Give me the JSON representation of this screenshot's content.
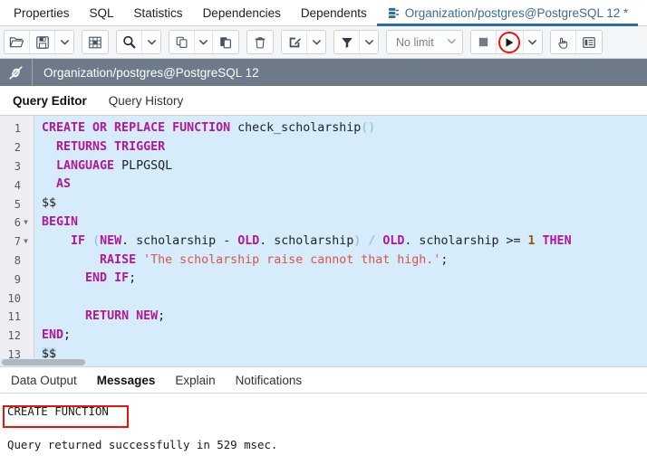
{
  "object_tabs": [
    {
      "label": "Properties",
      "active": false,
      "icon": null
    },
    {
      "label": "SQL",
      "active": false,
      "icon": null
    },
    {
      "label": "Statistics",
      "active": false,
      "icon": null
    },
    {
      "label": "Dependencies",
      "active": false,
      "icon": null
    },
    {
      "label": "Dependents",
      "active": false,
      "icon": null
    },
    {
      "label": "Organization/postgres@PostgreSQL 12 *",
      "active": true,
      "icon": "database-icon"
    }
  ],
  "toolbar": {
    "groups": [
      {
        "buttons": [
          {
            "name": "open-file-button",
            "icon": "open-folder-icon",
            "title": "Open File"
          },
          {
            "name": "save-file-button",
            "icon": "save-disk-icon",
            "title": "Save File"
          },
          {
            "name": "save-dropdown-button",
            "icon": "chevron-down-icon",
            "title": "Save options"
          }
        ]
      },
      {
        "buttons": [
          {
            "name": "edit-grid-button",
            "icon": "grid-icon",
            "title": "Edit grid"
          }
        ]
      },
      {
        "buttons": [
          {
            "name": "find-button",
            "icon": "search-icon",
            "title": "Find"
          },
          {
            "name": "find-dropdown-button",
            "icon": "chevron-down-icon",
            "title": "Find options"
          }
        ]
      },
      {
        "buttons": [
          {
            "name": "copy-button",
            "icon": "copy-icon",
            "title": "Copy"
          },
          {
            "name": "copy-dropdown-button",
            "icon": "chevron-down-icon",
            "title": "Copy options"
          },
          {
            "name": "paste-button",
            "icon": "paste-icon",
            "title": "Paste"
          }
        ]
      },
      {
        "buttons": [
          {
            "name": "delete-button",
            "icon": "trash-icon",
            "title": "Delete"
          }
        ]
      },
      {
        "buttons": [
          {
            "name": "edit-button",
            "icon": "pencil-square-icon",
            "title": "Edit"
          },
          {
            "name": "edit-dropdown-button",
            "icon": "chevron-down-icon",
            "title": "Edit options"
          }
        ]
      },
      {
        "buttons": [
          {
            "name": "filter-button",
            "icon": "funnel-icon",
            "title": "Filter"
          },
          {
            "name": "filter-dropdown-button",
            "icon": "chevron-down-icon",
            "title": "Filter options"
          }
        ]
      }
    ],
    "limit_label": "No limit",
    "limit_caret_icon": "chevron-down-icon",
    "stop_button": {
      "name": "stop-query-button",
      "icon": "stop-square-icon"
    },
    "play_button": {
      "name": "execute-query-button",
      "icon": "play-triangle-icon",
      "highlighted": true
    },
    "play_dropdown": {
      "name": "execute-dropdown-button",
      "icon": "chevron-down-icon"
    },
    "hand_button": {
      "name": "macro-hand-button",
      "icon": "hand-pointer-icon"
    },
    "panel_button": {
      "name": "panel-toggle-button",
      "icon": "list-panel-icon"
    }
  },
  "connection_bar": {
    "icon": "disconnect-plug-icon",
    "title": "Organization/postgres@PostgreSQL 12"
  },
  "editor_tabs": [
    {
      "label": "Query Editor",
      "active": true
    },
    {
      "label": "Query History",
      "active": false
    }
  ],
  "code": {
    "lines": [
      {
        "n": 1,
        "fold": false,
        "tokens": [
          {
            "t": "CREATE OR REPLACE FUNCTION",
            "c": "kw"
          },
          {
            "t": " check_scholarship",
            "c": "plain"
          },
          {
            "t": "()",
            "c": "paren"
          }
        ]
      },
      {
        "n": 2,
        "fold": false,
        "tokens": [
          {
            "t": "  ",
            "c": "plain"
          },
          {
            "t": "RETURNS TRIGGER",
            "c": "kw"
          }
        ]
      },
      {
        "n": 3,
        "fold": false,
        "tokens": [
          {
            "t": "  ",
            "c": "plain"
          },
          {
            "t": "LANGUAGE",
            "c": "kw"
          },
          {
            "t": " PLPGSQL",
            "c": "plain"
          }
        ]
      },
      {
        "n": 4,
        "fold": false,
        "tokens": [
          {
            "t": "  ",
            "c": "plain"
          },
          {
            "t": "AS",
            "c": "kw"
          }
        ]
      },
      {
        "n": 5,
        "fold": false,
        "tokens": [
          {
            "t": "$$",
            "c": "plain"
          }
        ]
      },
      {
        "n": 6,
        "fold": true,
        "tokens": [
          {
            "t": "BEGIN",
            "c": "kw"
          }
        ]
      },
      {
        "n": 7,
        "fold": true,
        "tokens": [
          {
            "t": "    ",
            "c": "plain"
          },
          {
            "t": "IF",
            "c": "kw"
          },
          {
            "t": " ",
            "c": "plain"
          },
          {
            "t": "(",
            "c": "paren"
          },
          {
            "t": "NEW",
            "c": "kw"
          },
          {
            "t": ". scholarship ",
            "c": "plain"
          },
          {
            "t": "-",
            "c": "plain"
          },
          {
            "t": " ",
            "c": "plain"
          },
          {
            "t": "OLD",
            "c": "kw"
          },
          {
            "t": ". scholarship",
            "c": "plain"
          },
          {
            "t": ")",
            "c": "paren"
          },
          {
            "t": " ",
            "c": "plain"
          },
          {
            "t": "/",
            "c": "paren"
          },
          {
            "t": " ",
            "c": "plain"
          },
          {
            "t": "OLD",
            "c": "kw"
          },
          {
            "t": ". scholarship >= ",
            "c": "plain"
          },
          {
            "t": "1",
            "c": "num-lit"
          },
          {
            "t": " ",
            "c": "plain"
          },
          {
            "t": "THEN",
            "c": "kw"
          }
        ]
      },
      {
        "n": 8,
        "fold": false,
        "tokens": [
          {
            "t": "        ",
            "c": "plain"
          },
          {
            "t": "RAISE",
            "c": "kw"
          },
          {
            "t": " ",
            "c": "plain"
          },
          {
            "t": "'The scholarship raise cannot that high.'",
            "c": "str"
          },
          {
            "t": ";",
            "c": "plain"
          }
        ]
      },
      {
        "n": 9,
        "fold": false,
        "tokens": [
          {
            "t": "      ",
            "c": "plain"
          },
          {
            "t": "END IF",
            "c": "kw"
          },
          {
            "t": ";",
            "c": "plain"
          }
        ]
      },
      {
        "n": 10,
        "fold": false,
        "tokens": [
          {
            "t": "",
            "c": "plain"
          }
        ]
      },
      {
        "n": 11,
        "fold": false,
        "tokens": [
          {
            "t": "      ",
            "c": "plain"
          },
          {
            "t": "RETURN NEW",
            "c": "kw"
          },
          {
            "t": ";",
            "c": "plain"
          }
        ]
      },
      {
        "n": 12,
        "fold": false,
        "tokens": [
          {
            "t": "END",
            "c": "kw"
          },
          {
            "t": ";",
            "c": "plain"
          }
        ]
      },
      {
        "n": 13,
        "fold": false,
        "tokens": [
          {
            "t": "$$",
            "c": "sel"
          }
        ]
      }
    ]
  },
  "bottom_tabs": [
    {
      "label": "Data Output",
      "active": false
    },
    {
      "label": "Messages",
      "active": true
    },
    {
      "label": "Explain",
      "active": false
    },
    {
      "label": "Notifications",
      "active": false
    }
  ],
  "messages": {
    "result": "CREATE FUNCTION",
    "status": "Query returned successfully in 529 msec."
  },
  "colors": {
    "accent": "#2c6ca3",
    "annotation": "#e8140c",
    "keyword": "#b0179a",
    "string": "#d9534f",
    "number": "#8a5a1c",
    "editor_bg": "#d6ecfb",
    "conn_bar_bg": "#6c7a89"
  }
}
